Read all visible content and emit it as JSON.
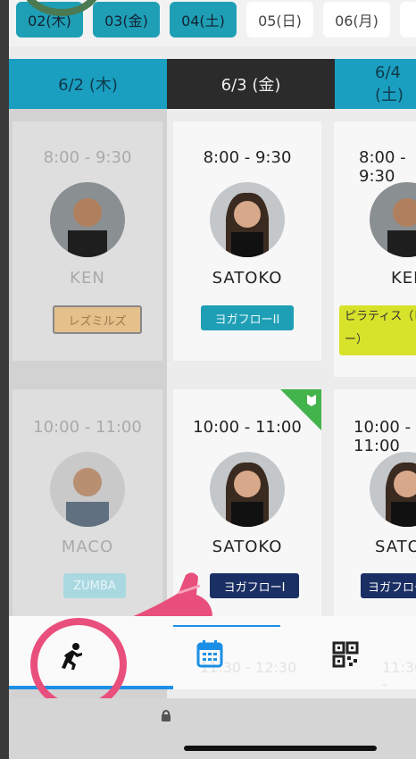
{
  "dates": [
    "02(木)",
    "03(金)",
    "04(土)",
    "05(日)",
    "06(月)"
  ],
  "day_headers": [
    "6/2 (木)",
    "6/3 (金)",
    "6/4 (土)"
  ],
  "cards": [
    {
      "time": "8:00 - 9:30",
      "name": "KEN",
      "tag": "レズミルズ"
    },
    {
      "time": "8:00 - 9:30",
      "name": "SATOKO",
      "tag": "ヨガフローII"
    },
    {
      "time": "8:00 - 9:30",
      "name": "KEN",
      "tag": "ピラティス（ビギナー）"
    },
    {
      "time": "10:00 - 11:00",
      "name": "MACO",
      "tag": "ZUMBA"
    },
    {
      "time": "10:00 - 11:00",
      "name": "SATOKO",
      "tag": "ヨガフローI"
    },
    {
      "time": "10:00 - 11:00",
      "name": "SATOKO",
      "tag": "ヨガフローI"
    }
  ],
  "tabbar": {
    "faded_time": "11:30 - 12:30",
    "icons": [
      "runner-icon",
      "calendar-icon",
      "qr-code-icon"
    ]
  },
  "colors": {
    "accent": "#1a9fc1",
    "highlight": "#e94f7c",
    "new_badge": "#43b34b",
    "nav_blue": "#1b8fe6"
  }
}
